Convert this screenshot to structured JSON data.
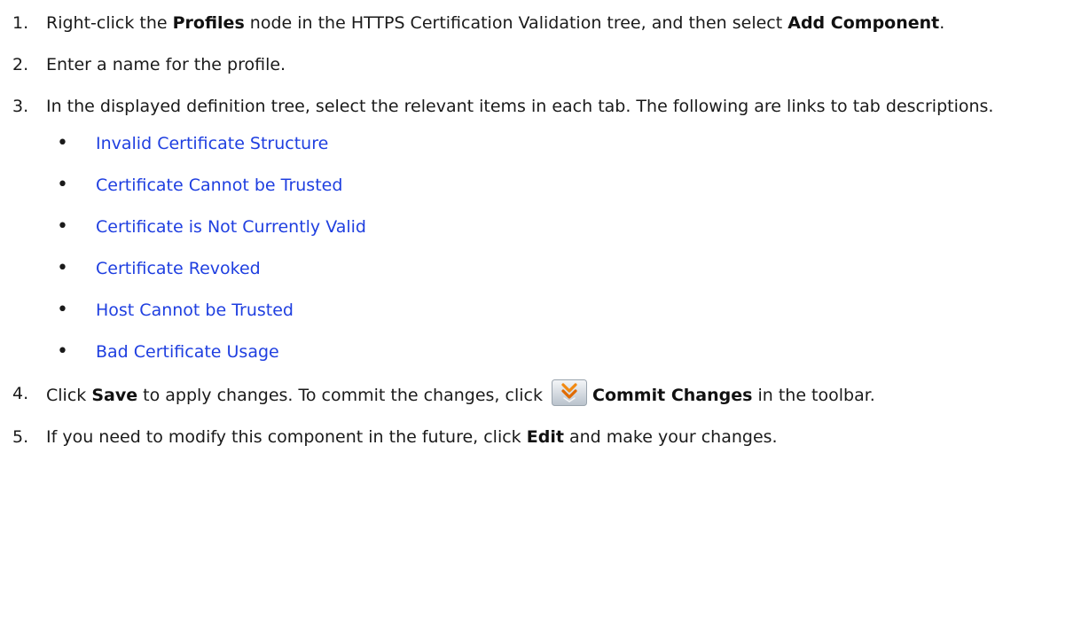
{
  "steps": [
    {
      "num": "1.",
      "t1": "Right-click the ",
      "b1": "Profiles",
      "t2": " node in the HTTPS Certification Validation tree, and then select ",
      "b2": "Add Component",
      "t3": "."
    },
    {
      "num": "2.",
      "t1": "Enter a name for the profile."
    },
    {
      "num": "3.",
      "t1": "In the displayed definition tree, select the relevant items in each tab. The following are links to tab descriptions.",
      "links": [
        "Invalid Certificate Structure",
        "Certificate Cannot be Trusted",
        "Certificate is Not Currently Valid",
        "Certificate Revoked",
        "Host Cannot be Trusted",
        "Bad Certificate Usage"
      ]
    },
    {
      "num": "4.",
      "t1": "Click ",
      "b1": "Save",
      "t2": " to apply changes. To commit the changes, click ",
      "icon": "commit-changes-icon",
      "b2": "Commit Changes",
      "t3": " in the toolbar."
    },
    {
      "num": "5.",
      "t1": "If you need to modify this component in the future, click ",
      "b1": "Edit",
      "t2": " and make your changes."
    }
  ],
  "bullet_char": "•",
  "colors": {
    "link": "#1f3fe0",
    "text": "#1a1a1a"
  }
}
